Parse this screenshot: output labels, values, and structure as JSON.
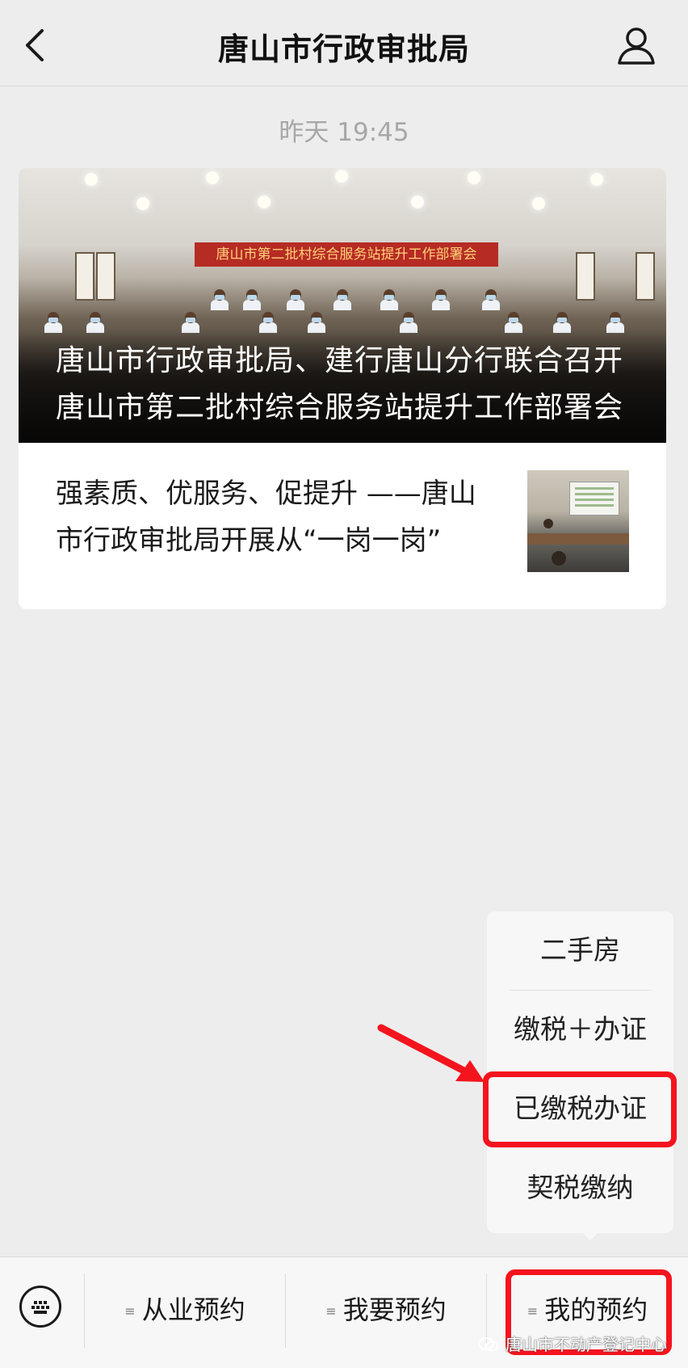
{
  "header": {
    "title": "唐山市行政审批局",
    "back_icon": "chevron-left-icon",
    "profile_icon": "person-icon"
  },
  "chat": {
    "timestamp": "昨天 19:45"
  },
  "article_card": {
    "main": {
      "title": "唐山市行政审批局、建行唐山分行联合召开唐山市第二批村综合服务站提升工作部署会",
      "cover_banner_text": "唐山市第二批村综合服务站提升工作部署会"
    },
    "sub": {
      "title": "强素质、优服务、促提升 ——唐山市行政审批局开展从“一岗一岗”"
    }
  },
  "popup_menu": {
    "items": [
      {
        "label": "二手房"
      },
      {
        "label": "缴税＋办证"
      },
      {
        "label": "已缴税办证"
      },
      {
        "label": "契税缴纳"
      }
    ]
  },
  "bottom_menu": {
    "keyboard_icon": "keyboard-icon",
    "items": [
      {
        "label": "从业预约"
      },
      {
        "label": "我要预约"
      },
      {
        "label": "我的预约"
      }
    ]
  },
  "watermark": {
    "text": "唐山市不动产登记中心"
  },
  "colors": {
    "background": "#ededed",
    "highlight": "#f4141e",
    "popup": "#f7f7f7"
  }
}
